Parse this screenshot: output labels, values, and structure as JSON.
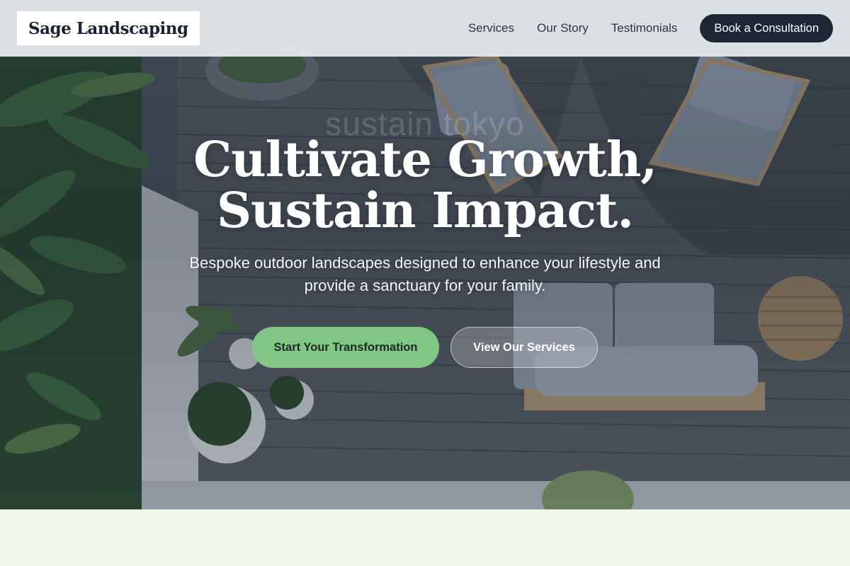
{
  "brand": {
    "name": "Sage Landscaping"
  },
  "nav": {
    "links": [
      "Services",
      "Our Story",
      "Testimonials"
    ],
    "cta_label": "Book a Consultation"
  },
  "hero": {
    "headline_line1": "Cultivate Growth,",
    "headline_line2": "Sustain Impact.",
    "ghost_text": "sustain tokyo",
    "subhead": "Bespoke outdoor landscapes designed to enhance your lifestyle and provide a sanctuary for your family.",
    "primary_button": "Start Your Transformation",
    "secondary_button": "View Our Services"
  },
  "colors": {
    "nav_bg": "#e8ecf0",
    "brand_text": "#1c2434",
    "cta_bg": "#1e2636",
    "primary_button_bg": "#80c685",
    "page_bg": "#f1f7e8"
  }
}
